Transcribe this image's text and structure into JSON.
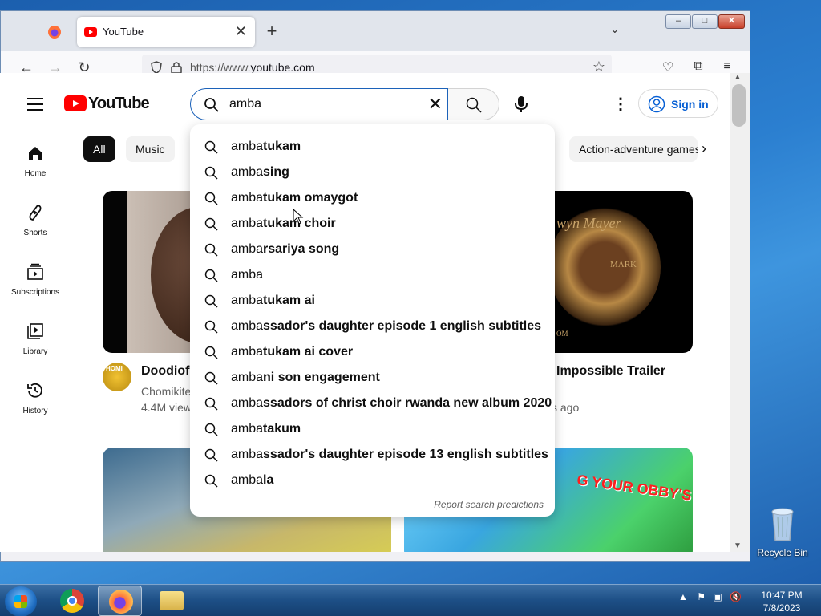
{
  "browser": {
    "tab_title": "YouTube",
    "new_tab": "+",
    "url_prefix": "https://www.",
    "url_domain": "youtube.com"
  },
  "youtube": {
    "logo_text": "YouTube",
    "search_query": "amba",
    "sign_in": "Sign in",
    "sidebar": [
      {
        "label": "Home",
        "icon": "home-icon"
      },
      {
        "label": "Shorts",
        "icon": "shorts-icon"
      },
      {
        "label": "Subscriptions",
        "icon": "subscriptions-icon"
      },
      {
        "label": "Library",
        "icon": "library-icon"
      },
      {
        "label": "History",
        "icon": "history-icon"
      }
    ],
    "chips": [
      "All",
      "Music",
      "Action-adventure games"
    ],
    "videos": [
      {
        "title": "Doodiofo",
        "channel": "Chomikite",
        "stats": "4.4M view"
      },
      {
        "title": "Impossible Trailer",
        "stats": "s ago"
      }
    ],
    "thumb_text": {
      "mgm_top": "wyn Mayer",
      "mgm_mark": "MARK",
      "mgm_com": "OM",
      "obby": "G YOUR OBBY'S",
      "avatar_text": "HOMI"
    },
    "suggestions": [
      {
        "prefix": "amba",
        "rest": "tukam"
      },
      {
        "prefix": "amba",
        "rest": "sing"
      },
      {
        "prefix": "amba",
        "rest": "tukam omaygot"
      },
      {
        "prefix": "amba",
        "rest": "tukam choir"
      },
      {
        "prefix": "amba",
        "rest": "rsariya song"
      },
      {
        "prefix": "amba",
        "rest": ""
      },
      {
        "prefix": "amba",
        "rest": "tukam ai"
      },
      {
        "prefix": "amba",
        "rest": "ssador's daughter episode 1 english subtitles"
      },
      {
        "prefix": "amba",
        "rest": "tukam ai cover"
      },
      {
        "prefix": "amba",
        "rest": "ni son engagement"
      },
      {
        "prefix": "amba",
        "rest": "ssadors of christ choir rwanda new album 2020"
      },
      {
        "prefix": "amba",
        "rest": "takum"
      },
      {
        "prefix": "amba",
        "rest": "ssador's daughter episode 13 english subtitles"
      },
      {
        "prefix": "amba",
        "rest": "la"
      }
    ],
    "report_text": "Report search predictions"
  },
  "desktop": {
    "recycle_bin": "Recycle Bin",
    "clock_time": "10:47 PM",
    "clock_date": "7/8/2023"
  }
}
